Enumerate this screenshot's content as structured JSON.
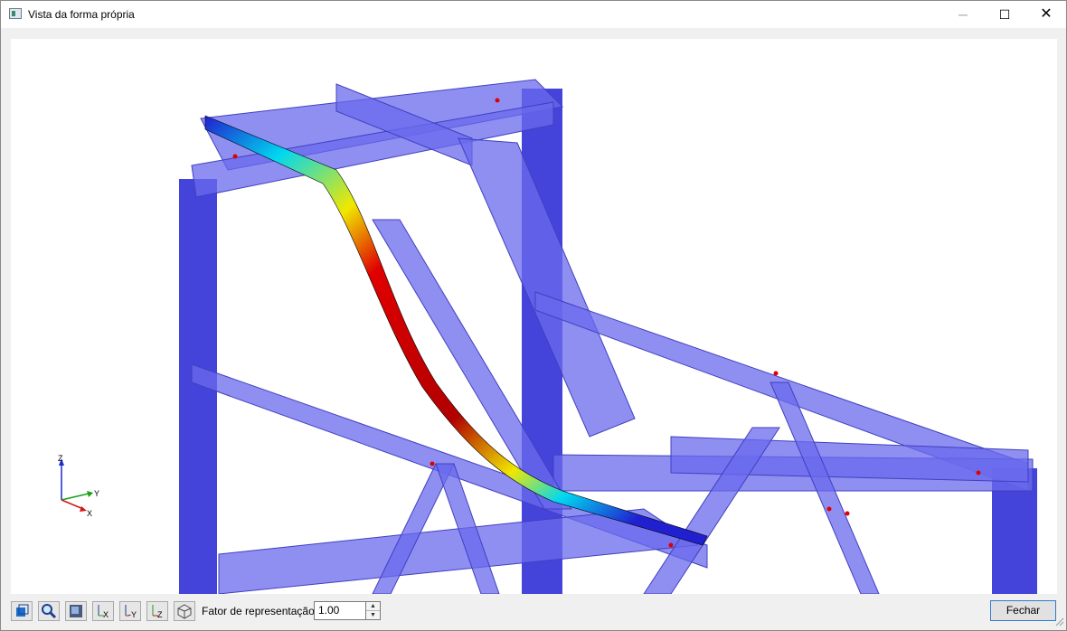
{
  "window": {
    "title": "Vista da forma própria",
    "minimize_icon": "minimize-icon",
    "maximize_icon": "maximize-icon",
    "close_icon": "close-icon"
  },
  "viewport": {
    "axes": {
      "z": "Z",
      "y": "Y",
      "x": "X"
    },
    "colors": {
      "members": "#4a4ae0",
      "members_transparent": "#7878f0",
      "mode_max": "#e00000",
      "mode_mid": "#f0e800",
      "mode_low": "#00d8f0",
      "mode_min": "#2020d0"
    }
  },
  "toolbar": {
    "buttons": [
      {
        "name": "view-options-button",
        "icon": "cube-settings-icon"
      },
      {
        "name": "zoom-button",
        "icon": "magnifier-icon"
      },
      {
        "name": "render-mode-button",
        "icon": "render-icon"
      },
      {
        "name": "view-x-button",
        "icon": "axis-x-icon",
        "label": "X"
      },
      {
        "name": "view-minus-y-button",
        "icon": "axis-minus-y-icon",
        "label": "-Y"
      },
      {
        "name": "view-z-button",
        "icon": "axis-z-icon",
        "label": "Z"
      },
      {
        "name": "isometric-view-button",
        "icon": "isometric-icon"
      }
    ],
    "factor_label": "Fator de representação:",
    "factor_value": "1.00",
    "close_label": "Fechar"
  }
}
